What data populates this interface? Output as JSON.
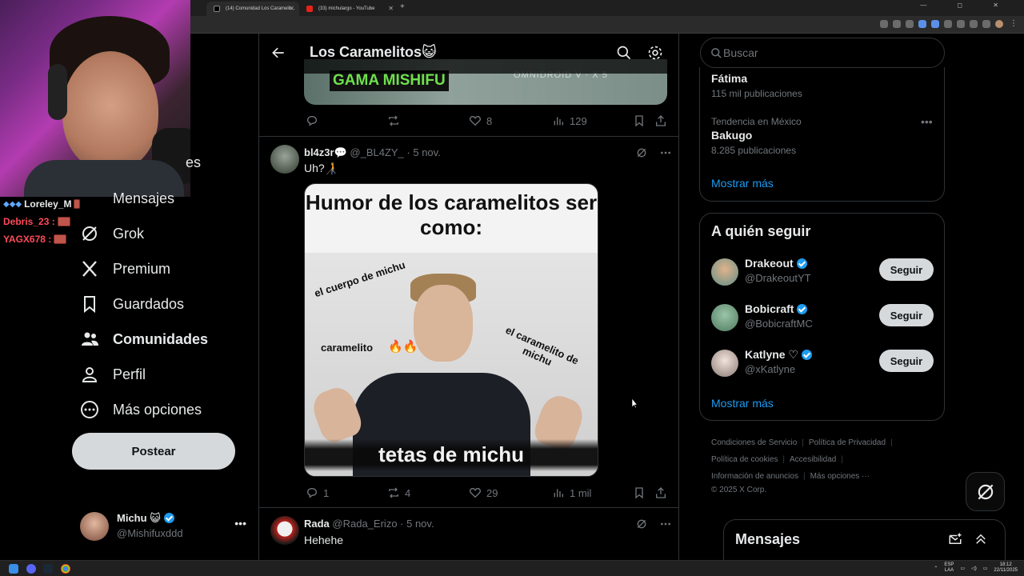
{
  "browser": {
    "tabs": [
      {
        "label": "(14) Comunidad Los Caramelit...",
        "active": true
      },
      {
        "label": "(33) michulargo - YouTube",
        "active": false
      }
    ],
    "window_controls": "— ◻ ✕"
  },
  "stream_chat": [
    {
      "user": "Loreley_M",
      "color": "#e7e9ea"
    },
    {
      "user": "Debris_23 :",
      "color": "#ff4a5a"
    },
    {
      "user": "YAGX678 :",
      "color": "#ff4a5a"
    }
  ],
  "sidebar": {
    "partial_label": "es",
    "items": [
      {
        "label": "Mensajes",
        "icon": "mail-icon"
      },
      {
        "label": "Grok",
        "icon": "grok-icon"
      },
      {
        "label": "Premium",
        "icon": "x-logo-icon"
      },
      {
        "label": "Guardados",
        "icon": "bookmark-icon"
      },
      {
        "label": "Comunidades",
        "icon": "communities-icon",
        "active": true
      },
      {
        "label": "Perfil",
        "icon": "person-icon"
      },
      {
        "label": "Más opciones",
        "icon": "more-circle-icon"
      }
    ],
    "post_button": "Postear",
    "account": {
      "name": "Michu 😺",
      "handle": "@Mishifuxddd"
    }
  },
  "main": {
    "title": "Los Caramelitos😺",
    "prev_post": {
      "image_text": "GAMA MISHIFU",
      "image_subtext": "OMNIDROID V · X 5",
      "likes": "8",
      "views": "129"
    },
    "tweets": [
      {
        "name": "bl4z3r💬",
        "handle": "@_BL4ZY_",
        "date": "· 5 nov.",
        "text": "Uh?🧑‍🦯",
        "meme": {
          "title": "Humor de los caramelitos ser como:",
          "label_body": "el cuerpo de michu",
          "label_caramelito": "caramelito",
          "label_fire": "🔥🔥",
          "label_caramelo": "el caramelito de michu",
          "bottom": "tetas de michu"
        },
        "replies": "1",
        "reposts": "4",
        "likes": "29",
        "views": "1 mil"
      },
      {
        "name": "Rada",
        "handle": "@Rada_Erizo",
        "date": "· 5 nov.",
        "text": "Hehehe"
      }
    ]
  },
  "right": {
    "search_placeholder": "Buscar",
    "trends": [
      {
        "context": "",
        "name": "Fátima",
        "count": "115 mil publicaciones"
      },
      {
        "context": "Tendencia en México",
        "name": "Bakugo",
        "count": "8.285 publicaciones"
      }
    ],
    "trends_show_more": "Mostrar más",
    "who_to_follow_title": "A quién seguir",
    "who_to_follow": [
      {
        "name": "Drakeout",
        "handle": "@DrakeoutYT",
        "button": "Seguir",
        "avatar_color": "#5f8f86"
      },
      {
        "name": "Bobicraft",
        "handle": "@BobicraftMC",
        "button": "Seguir",
        "avatar_color": "#6f9a7a"
      },
      {
        "name": "Katlyne ♡",
        "handle": "@xKatlyne",
        "button": "Seguir",
        "avatar_color": "#d9c7c0"
      }
    ],
    "follow_show_more": "Mostrar más",
    "footer": [
      "Condiciones de Servicio",
      "Política de Privacidad",
      "Política de cookies",
      "Accesibilidad",
      "Información de anuncios",
      "Más opciones ···",
      "© 2025 X Corp."
    ],
    "messages_title": "Mensajes"
  },
  "taskbar": {
    "lang": "ESP",
    "lang2": "LAA",
    "time": "18:12",
    "date": "22/11/2025"
  },
  "colors": {
    "accent": "#1d9bf0",
    "background": "#000000",
    "border": "#2f3336",
    "muted": "#71767b"
  }
}
